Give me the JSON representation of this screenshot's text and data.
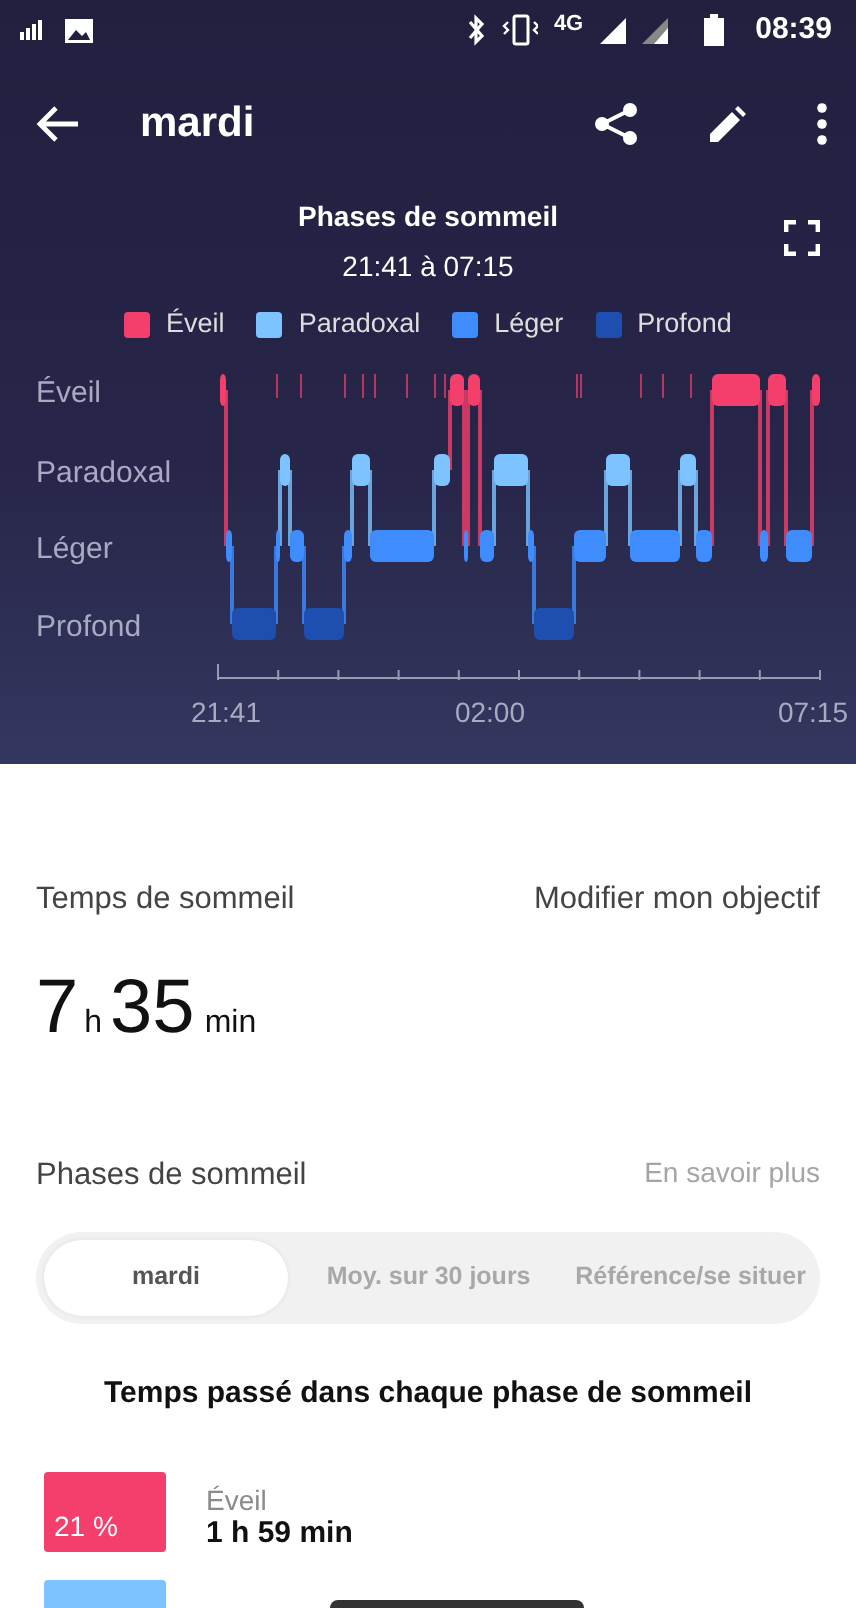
{
  "status_bar": {
    "time": "08:39",
    "network": "4G"
  },
  "app_bar": {
    "title": "mardi"
  },
  "chart_header": {
    "title": "Phases de sommeil",
    "range": "21:41 à 07:15"
  },
  "legend": [
    {
      "label": "Éveil",
      "color": "#f43f6c"
    },
    {
      "label": "Paradoxal",
      "color": "#7cc3ff"
    },
    {
      "label": "Léger",
      "color": "#3f8cff"
    },
    {
      "label": "Profond",
      "color": "#1e4fb0"
    }
  ],
  "y_labels": [
    "Éveil",
    "Paradoxal",
    "Léger",
    "Profond"
  ],
  "x_labels": [
    "21:41",
    "02:00",
    "07:15"
  ],
  "sleep_time": {
    "label": "Temps de sommeil",
    "link": "Modifier mon objectif",
    "hours": "7",
    "hours_unit": "h",
    "minutes": "35",
    "minutes_unit": "min"
  },
  "phases": {
    "label": "Phases de sommeil",
    "link": "En savoir plus"
  },
  "segments": [
    {
      "label": "mardi",
      "selected": true
    },
    {
      "label": "Moy. sur 30 jours",
      "selected": false
    },
    {
      "label": "Référence/se situer",
      "selected": false
    }
  ],
  "breakdown_title": "Temps passé dans chaque phase de sommeil",
  "breakdown": [
    {
      "percent": "21 %",
      "name": "Éveil",
      "duration": "1 h 59 min",
      "color": "#f43f6c"
    },
    {
      "color": "#7cc3ff"
    }
  ]
}
